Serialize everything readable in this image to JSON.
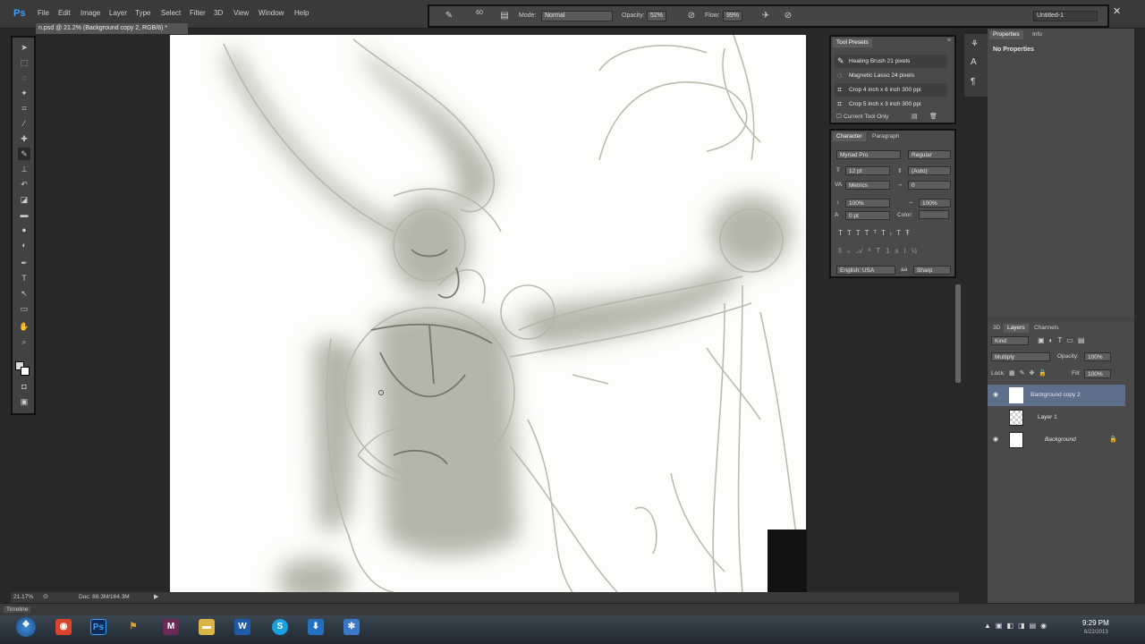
{
  "app": {
    "logo": "Ps"
  },
  "menu": [
    "File",
    "Edit",
    "Image",
    "Layer",
    "Type",
    "Select",
    "Filter",
    "3D",
    "View",
    "Window",
    "Help"
  ],
  "options": {
    "brush_size": "60",
    "mode_label": "Mode:",
    "mode_value": "Normal",
    "opacity_label": "Opacity:",
    "opacity_value": "52%",
    "flow_label": "Flow:",
    "flow_value": "99%",
    "workspace": "Untitled-1"
  },
  "document": {
    "tab_title": "n.psd @ 21.2% (Background copy 2, RGB/8) *"
  },
  "tool_presets": {
    "title": "Tool Presets",
    "items": [
      "Healing Brush 21 pixels",
      "Magnetic Lasso 24 pixels",
      "Crop 4 inch x 6 inch 300 ppi",
      "Crop 5 inch x 3 inch 300 ppi"
    ],
    "footer": "Current Tool Only"
  },
  "character": {
    "tabs": [
      "Character",
      "Paragraph"
    ],
    "font_family": "Myriad Pro",
    "font_style": "Regular",
    "font_size": "12 pt",
    "leading": "(Auto)",
    "kerning": "Metrics",
    "tracking": "0",
    "vertical_scale": "100%",
    "horizontal_scale": "100%",
    "baseline_shift": "0 pt",
    "color_label": "Color:",
    "language": "English: USA",
    "antialias": "Sharp"
  },
  "properties": {
    "tabs": [
      "Properties",
      "Info"
    ],
    "content": "No Properties"
  },
  "layers": {
    "tabs": [
      "3D",
      "Layers",
      "Channels"
    ],
    "filter_kind": "Kind",
    "blend_mode": "Multiply",
    "opacity_label": "Opacity:",
    "opacity_value": "100%",
    "lock_label": "Lock:",
    "fill_label": "Fill:",
    "fill_value": "100%",
    "items": [
      {
        "name": "Background copy 2",
        "selected": true
      },
      {
        "name": "Layer 1",
        "selected": false
      },
      {
        "name": "Background",
        "selected": false
      }
    ]
  },
  "status": {
    "zoom": "21.17%",
    "doc": "Doc: 88.3M/164.3M"
  },
  "timeline": {
    "label": "Timeline"
  },
  "taskbar": {
    "time": "9:29 PM",
    "date": "6/22/2013"
  },
  "colors": {
    "accent": "#36a2ff",
    "selected_layer": "#5d6f8a",
    "panel_bg": "#4a4a4a"
  }
}
